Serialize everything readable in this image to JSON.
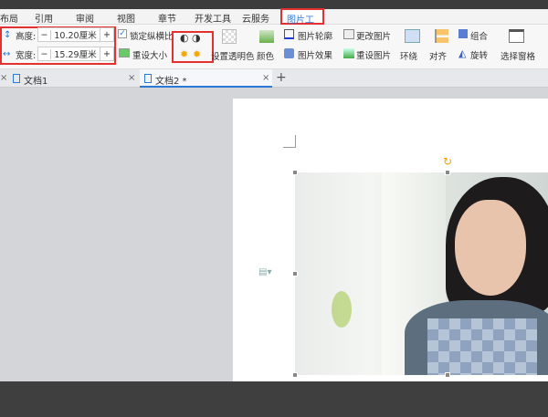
{
  "menu": [
    "布局",
    "引用",
    "审阅",
    "视图",
    "章节",
    "开发工具",
    "云服务",
    "图片工具"
  ],
  "size": {
    "height_label": "高度:",
    "height_value": "10.20厘米",
    "width_label": "宽度:",
    "width_value": "15.29厘米",
    "minus": "−",
    "plus": "+"
  },
  "ribbon": {
    "lock_ratio": "锁定纵横比",
    "reset_size": "重设大小",
    "set_transparent": "设置透明色",
    "color": "颜色",
    "outline": "图片轮廓",
    "effect": "图片效果",
    "change_pic": "更改图片",
    "reset_pic": "重设图片",
    "wrap": "环绕",
    "align": "对齐",
    "group": "组合",
    "rotate": "旋转",
    "select_pane": "选择窗格"
  },
  "doc_tabs": [
    {
      "label": "文档1"
    },
    {
      "label": "文档2 *"
    }
  ],
  "colors": {
    "accent": "#2b79d6",
    "highlight": "#e53030"
  }
}
